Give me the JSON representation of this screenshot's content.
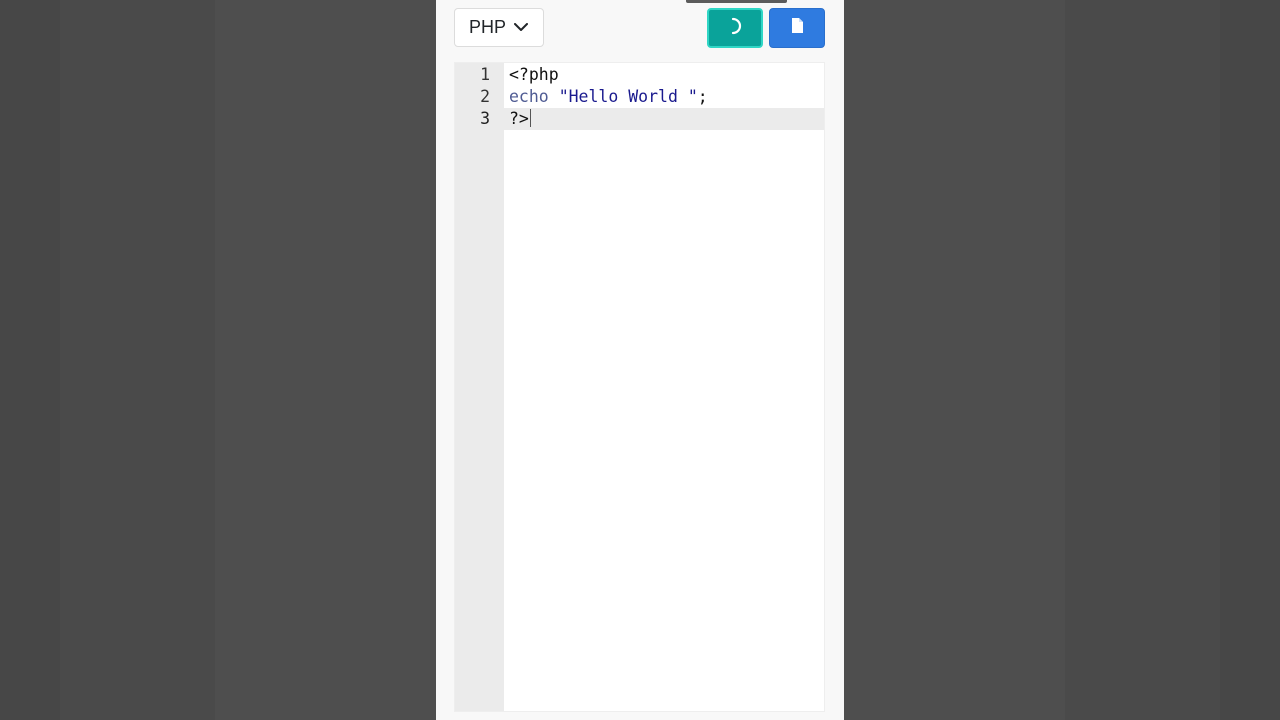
{
  "toolbar": {
    "language_label": "PHP",
    "run_icon": "spinner-icon",
    "save_icon": "file-icon",
    "colors": {
      "run": "#0aa39a",
      "save": "#2f7be0"
    }
  },
  "editor": {
    "lines": [
      {
        "number": "1",
        "tokens": [
          {
            "type": "plain",
            "text": "<?php"
          }
        ]
      },
      {
        "number": "2",
        "tokens": [
          {
            "type": "kw",
            "text": "echo"
          },
          {
            "type": "plain",
            "text": " "
          },
          {
            "type": "str",
            "text": "\"Hello World \""
          },
          {
            "type": "plain",
            "text": ";"
          }
        ]
      },
      {
        "number": "3",
        "tokens": [
          {
            "type": "plain",
            "text": "?>"
          }
        ]
      }
    ],
    "active_line": 3
  }
}
